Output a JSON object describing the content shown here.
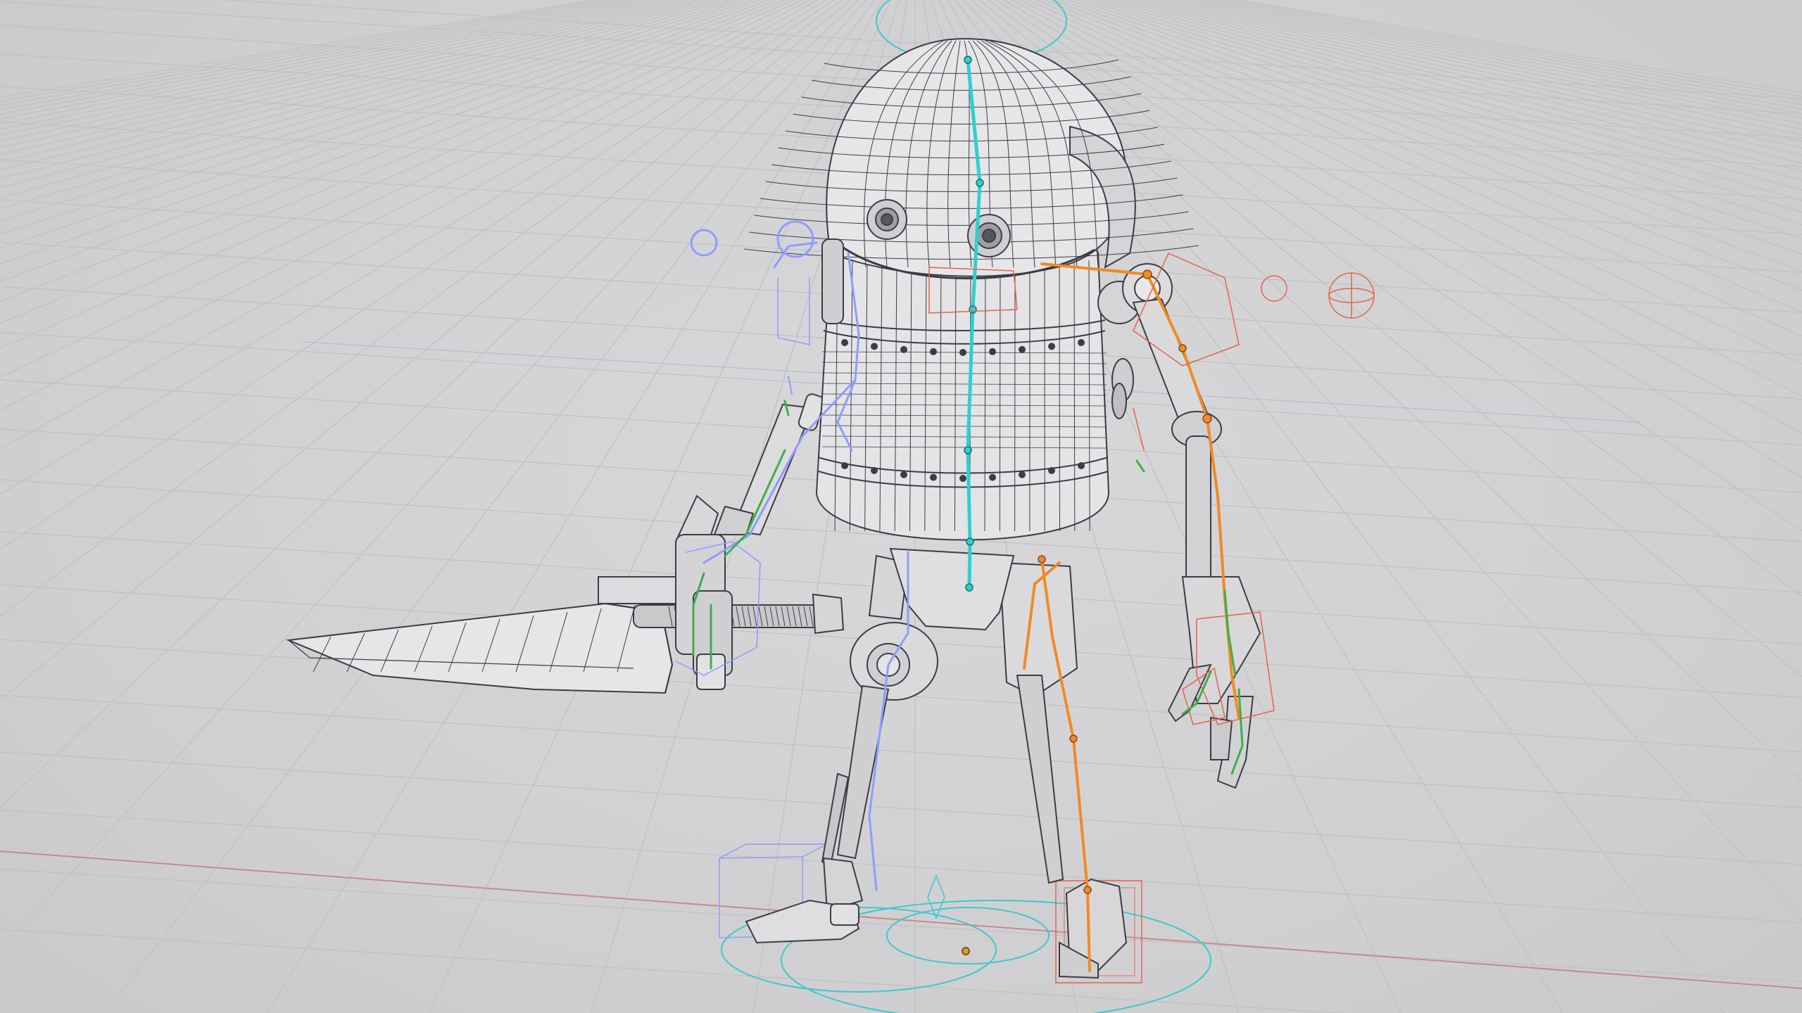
{
  "viewport": {
    "mode": "wireframe-overlay",
    "background": "#d2d2d4",
    "grid_color": "#c0c0c4",
    "x_axis_color": "#c98a8a",
    "y_axis_color": "#93b59a"
  },
  "model": {
    "wire_color": "#3b3d44",
    "surface_color": "#e2e2e4"
  },
  "rig": {
    "spine_color": "#2fcfd0",
    "left_side_color": "#8f9cff",
    "right_side_color": "#f08a24",
    "right_control_color": "#e2644a",
    "finger_bone_color": "#3dae4c",
    "root_circle_color": "#3fc7cf"
  },
  "icons": [
    "grid-floor-icon",
    "robot-mesh-icon",
    "armature-icon",
    "control-widget-icon"
  ]
}
